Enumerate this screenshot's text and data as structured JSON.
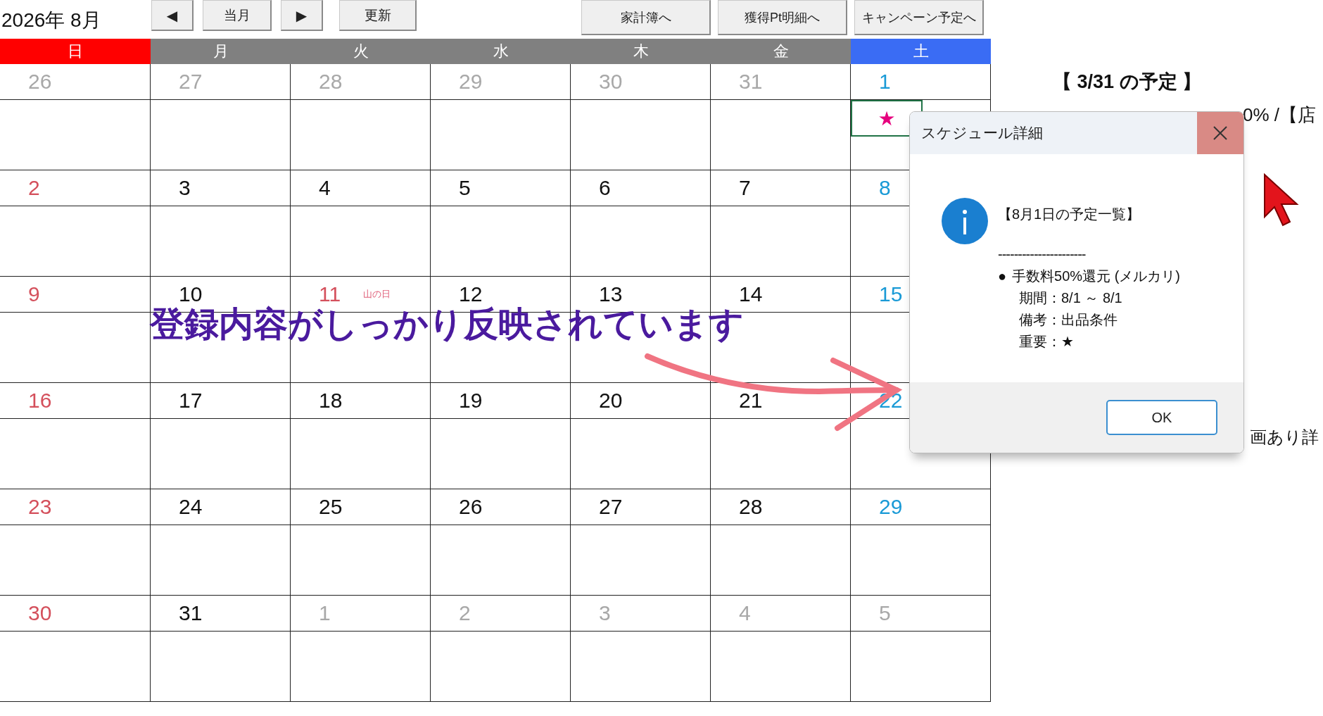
{
  "header": {
    "month_title": "2026年 8月",
    "nav_buttons": [
      "◀",
      "当月",
      "▶",
      "更新"
    ],
    "link_buttons": [
      "家計簿へ",
      "獲得Pt明細へ",
      "キャンペーン予定へ"
    ]
  },
  "weekdays": [
    {
      "label": "日",
      "kind": "sun"
    },
    {
      "label": "月",
      "kind": "weekday"
    },
    {
      "label": "火",
      "kind": "weekday"
    },
    {
      "label": "水",
      "kind": "weekday"
    },
    {
      "label": "木",
      "kind": "weekday"
    },
    {
      "label": "金",
      "kind": "weekday"
    },
    {
      "label": "土",
      "kind": "sat"
    }
  ],
  "weeks": [
    [
      {
        "day": "26",
        "kind": "other"
      },
      {
        "day": "27",
        "kind": "other"
      },
      {
        "day": "28",
        "kind": "other"
      },
      {
        "day": "29",
        "kind": "other"
      },
      {
        "day": "30",
        "kind": "other"
      },
      {
        "day": "31",
        "kind": "other"
      },
      {
        "day": "1",
        "kind": "sat",
        "event": {
          "mark": "★",
          "selected": true
        }
      }
    ],
    [
      {
        "day": "2",
        "kind": "sun"
      },
      {
        "day": "3",
        "kind": "normal"
      },
      {
        "day": "4",
        "kind": "normal"
      },
      {
        "day": "5",
        "kind": "normal"
      },
      {
        "day": "6",
        "kind": "normal"
      },
      {
        "day": "7",
        "kind": "normal"
      },
      {
        "day": "8",
        "kind": "sat"
      }
    ],
    [
      {
        "day": "9",
        "kind": "sun"
      },
      {
        "day": "10",
        "kind": "normal"
      },
      {
        "day": "11",
        "kind": "holiday",
        "holiday": "山の日"
      },
      {
        "day": "12",
        "kind": "normal"
      },
      {
        "day": "13",
        "kind": "normal"
      },
      {
        "day": "14",
        "kind": "normal"
      },
      {
        "day": "15",
        "kind": "sat"
      }
    ],
    [
      {
        "day": "16",
        "kind": "sun"
      },
      {
        "day": "17",
        "kind": "normal"
      },
      {
        "day": "18",
        "kind": "normal"
      },
      {
        "day": "19",
        "kind": "normal"
      },
      {
        "day": "20",
        "kind": "normal"
      },
      {
        "day": "21",
        "kind": "normal"
      },
      {
        "day": "22",
        "kind": "sat"
      }
    ],
    [
      {
        "day": "23",
        "kind": "sun"
      },
      {
        "day": "24",
        "kind": "normal"
      },
      {
        "day": "25",
        "kind": "normal"
      },
      {
        "day": "26",
        "kind": "normal"
      },
      {
        "day": "27",
        "kind": "normal"
      },
      {
        "day": "28",
        "kind": "normal"
      },
      {
        "day": "29",
        "kind": "sat"
      }
    ],
    [
      {
        "day": "30",
        "kind": "sun"
      },
      {
        "day": "31",
        "kind": "normal"
      },
      {
        "day": "1",
        "kind": "other"
      },
      {
        "day": "2",
        "kind": "other"
      },
      {
        "day": "3",
        "kind": "other"
      },
      {
        "day": "4",
        "kind": "other"
      },
      {
        "day": "5",
        "kind": "other"
      }
    ]
  ],
  "side_panel": {
    "title": "【 3/31 の予定 】",
    "line_1": "0% /【店",
    "line_2": "画あり詳"
  },
  "annotation": {
    "caption": "登録内容がしっかり反映されています"
  },
  "dialog": {
    "title": "スケジュール詳細",
    "heading": "【8月1日の予定一覧】",
    "separator": "----------------------",
    "bullet": "●",
    "item": "手数料50%還元 (メルカリ)",
    "details": [
      "期間：8/1 ～ 8/1",
      "備考：出品条件",
      "重要：★"
    ],
    "ok_button": "OK"
  }
}
